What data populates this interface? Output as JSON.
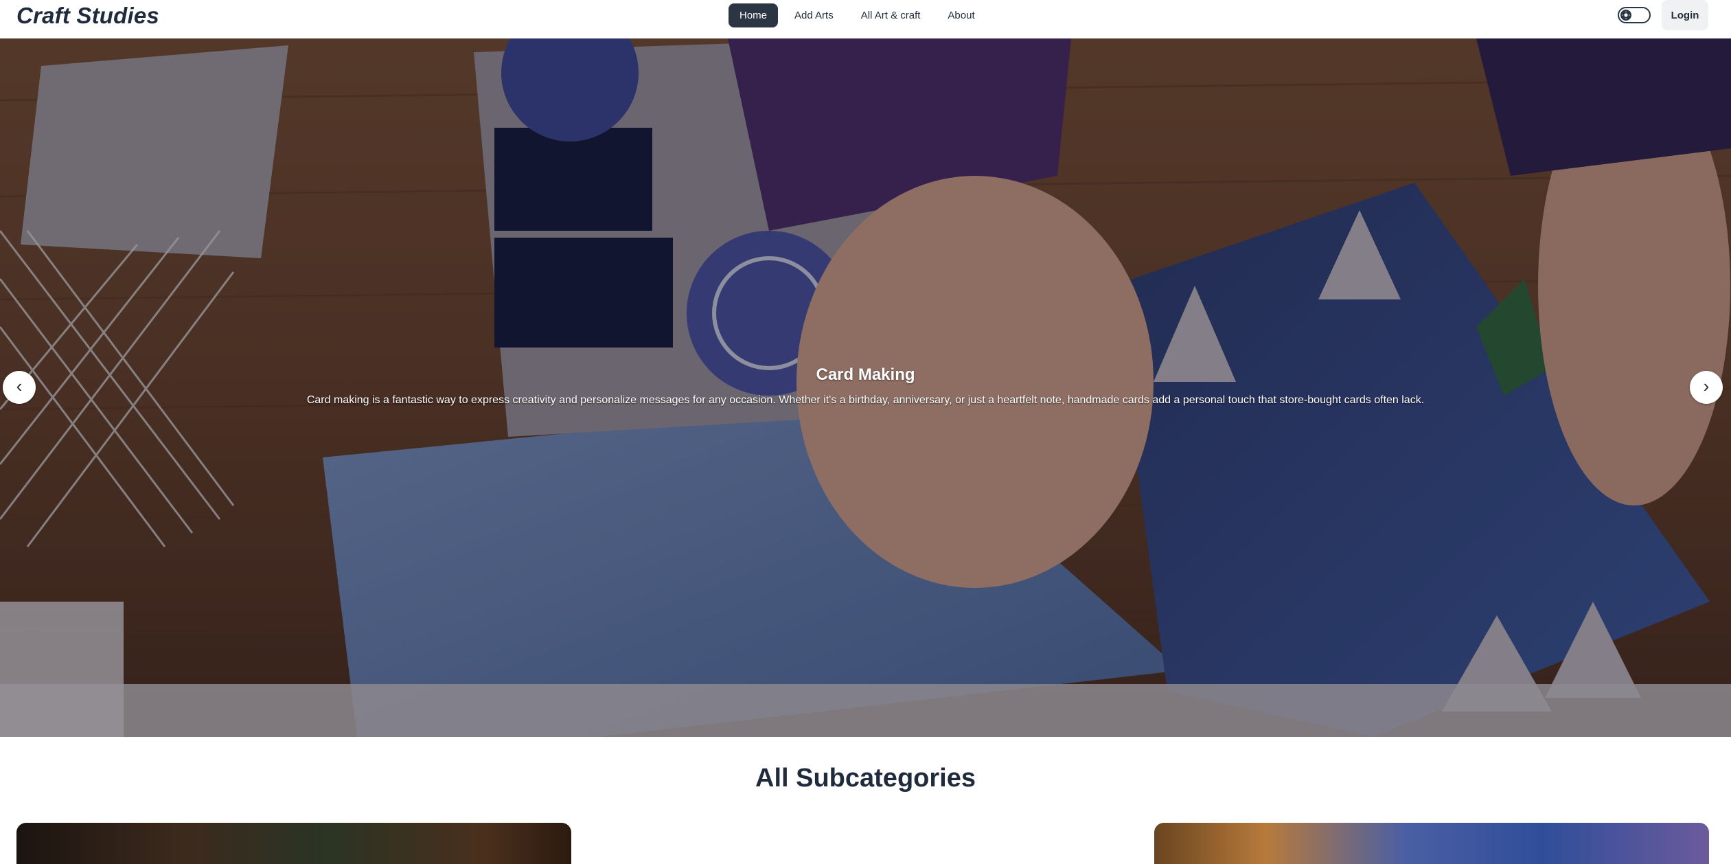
{
  "navbar": {
    "brand": "Craft Studies",
    "items": [
      {
        "label": "Home",
        "active": true
      },
      {
        "label": "Add Arts",
        "active": false
      },
      {
        "label": "All Art & craft",
        "active": false
      },
      {
        "label": "About",
        "active": false
      }
    ],
    "login_label": "Login"
  },
  "hero": {
    "title": "Card Making",
    "description": "Card making is a fantastic way to express creativity and personalize messages for any occasion. Whether it's a birthday, anniversary, or just a heartfelt note, handmade cards add a personal touch that store-bought cards often lack.",
    "prev_icon": "‹",
    "next_icon": "›"
  },
  "subcategories": {
    "title": "All Subcategories"
  },
  "colors": {
    "nav_active": "#2b3544",
    "text_dark": "#1f2a3d"
  }
}
